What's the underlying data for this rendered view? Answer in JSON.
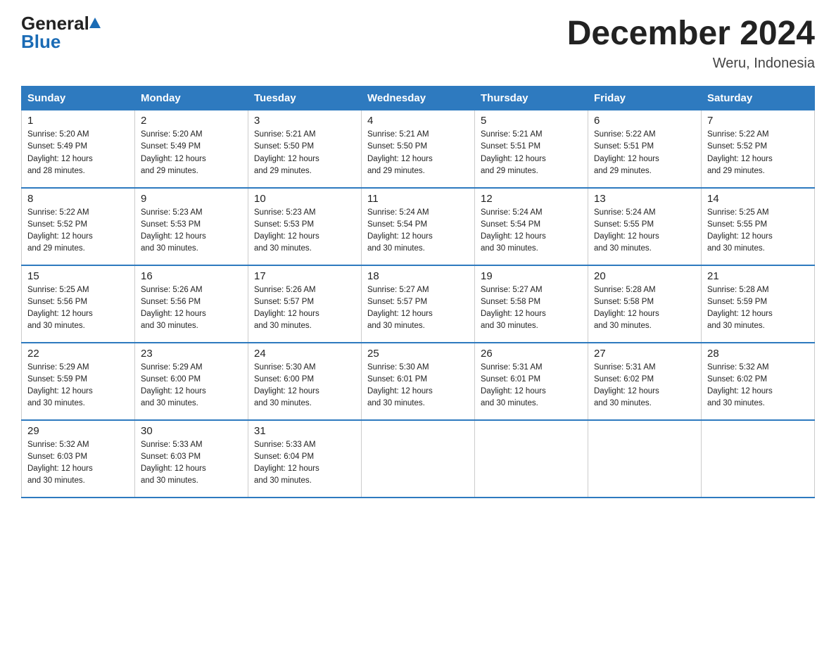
{
  "logo": {
    "general": "General",
    "blue": "Blue"
  },
  "header": {
    "month": "December 2024",
    "location": "Weru, Indonesia"
  },
  "days_of_week": [
    "Sunday",
    "Monday",
    "Tuesday",
    "Wednesday",
    "Thursday",
    "Friday",
    "Saturday"
  ],
  "weeks": [
    [
      {
        "day": "1",
        "sunrise": "5:20 AM",
        "sunset": "5:49 PM",
        "daylight": "12 hours and 28 minutes."
      },
      {
        "day": "2",
        "sunrise": "5:20 AM",
        "sunset": "5:49 PM",
        "daylight": "12 hours and 29 minutes."
      },
      {
        "day": "3",
        "sunrise": "5:21 AM",
        "sunset": "5:50 PM",
        "daylight": "12 hours and 29 minutes."
      },
      {
        "day": "4",
        "sunrise": "5:21 AM",
        "sunset": "5:50 PM",
        "daylight": "12 hours and 29 minutes."
      },
      {
        "day": "5",
        "sunrise": "5:21 AM",
        "sunset": "5:51 PM",
        "daylight": "12 hours and 29 minutes."
      },
      {
        "day": "6",
        "sunrise": "5:22 AM",
        "sunset": "5:51 PM",
        "daylight": "12 hours and 29 minutes."
      },
      {
        "day": "7",
        "sunrise": "5:22 AM",
        "sunset": "5:52 PM",
        "daylight": "12 hours and 29 minutes."
      }
    ],
    [
      {
        "day": "8",
        "sunrise": "5:22 AM",
        "sunset": "5:52 PM",
        "daylight": "12 hours and 29 minutes."
      },
      {
        "day": "9",
        "sunrise": "5:23 AM",
        "sunset": "5:53 PM",
        "daylight": "12 hours and 30 minutes."
      },
      {
        "day": "10",
        "sunrise": "5:23 AM",
        "sunset": "5:53 PM",
        "daylight": "12 hours and 30 minutes."
      },
      {
        "day": "11",
        "sunrise": "5:24 AM",
        "sunset": "5:54 PM",
        "daylight": "12 hours and 30 minutes."
      },
      {
        "day": "12",
        "sunrise": "5:24 AM",
        "sunset": "5:54 PM",
        "daylight": "12 hours and 30 minutes."
      },
      {
        "day": "13",
        "sunrise": "5:24 AM",
        "sunset": "5:55 PM",
        "daylight": "12 hours and 30 minutes."
      },
      {
        "day": "14",
        "sunrise": "5:25 AM",
        "sunset": "5:55 PM",
        "daylight": "12 hours and 30 minutes."
      }
    ],
    [
      {
        "day": "15",
        "sunrise": "5:25 AM",
        "sunset": "5:56 PM",
        "daylight": "12 hours and 30 minutes."
      },
      {
        "day": "16",
        "sunrise": "5:26 AM",
        "sunset": "5:56 PM",
        "daylight": "12 hours and 30 minutes."
      },
      {
        "day": "17",
        "sunrise": "5:26 AM",
        "sunset": "5:57 PM",
        "daylight": "12 hours and 30 minutes."
      },
      {
        "day": "18",
        "sunrise": "5:27 AM",
        "sunset": "5:57 PM",
        "daylight": "12 hours and 30 minutes."
      },
      {
        "day": "19",
        "sunrise": "5:27 AM",
        "sunset": "5:58 PM",
        "daylight": "12 hours and 30 minutes."
      },
      {
        "day": "20",
        "sunrise": "5:28 AM",
        "sunset": "5:58 PM",
        "daylight": "12 hours and 30 minutes."
      },
      {
        "day": "21",
        "sunrise": "5:28 AM",
        "sunset": "5:59 PM",
        "daylight": "12 hours and 30 minutes."
      }
    ],
    [
      {
        "day": "22",
        "sunrise": "5:29 AM",
        "sunset": "5:59 PM",
        "daylight": "12 hours and 30 minutes."
      },
      {
        "day": "23",
        "sunrise": "5:29 AM",
        "sunset": "6:00 PM",
        "daylight": "12 hours and 30 minutes."
      },
      {
        "day": "24",
        "sunrise": "5:30 AM",
        "sunset": "6:00 PM",
        "daylight": "12 hours and 30 minutes."
      },
      {
        "day": "25",
        "sunrise": "5:30 AM",
        "sunset": "6:01 PM",
        "daylight": "12 hours and 30 minutes."
      },
      {
        "day": "26",
        "sunrise": "5:31 AM",
        "sunset": "6:01 PM",
        "daylight": "12 hours and 30 minutes."
      },
      {
        "day": "27",
        "sunrise": "5:31 AM",
        "sunset": "6:02 PM",
        "daylight": "12 hours and 30 minutes."
      },
      {
        "day": "28",
        "sunrise": "5:32 AM",
        "sunset": "6:02 PM",
        "daylight": "12 hours and 30 minutes."
      }
    ],
    [
      {
        "day": "29",
        "sunrise": "5:32 AM",
        "sunset": "6:03 PM",
        "daylight": "12 hours and 30 minutes."
      },
      {
        "day": "30",
        "sunrise": "5:33 AM",
        "sunset": "6:03 PM",
        "daylight": "12 hours and 30 minutes."
      },
      {
        "day": "31",
        "sunrise": "5:33 AM",
        "sunset": "6:04 PM",
        "daylight": "12 hours and 30 minutes."
      },
      null,
      null,
      null,
      null
    ]
  ],
  "labels": {
    "sunrise": "Sunrise:",
    "sunset": "Sunset:",
    "daylight": "Daylight:"
  }
}
